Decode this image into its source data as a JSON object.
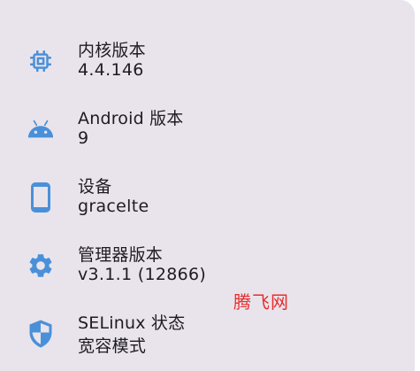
{
  "colors": {
    "accent": "#4a90d9",
    "card_bg": "#e9e4ec",
    "text": "#1f1b22",
    "watermark": "#e62e2e"
  },
  "items": [
    {
      "icon": "chip-icon",
      "title": "内核版本",
      "value": "4.4.146"
    },
    {
      "icon": "android-icon",
      "title": "Android 版本",
      "value": "9"
    },
    {
      "icon": "phone-icon",
      "title": "设备",
      "value": "gracelte"
    },
    {
      "icon": "gear-icon",
      "title": "管理器版本",
      "value": "v3.1.1 (12866)"
    },
    {
      "icon": "shield-icon",
      "title": "SELinux 状态",
      "value": "宽容模式"
    }
  ],
  "watermark": "腾飞网"
}
